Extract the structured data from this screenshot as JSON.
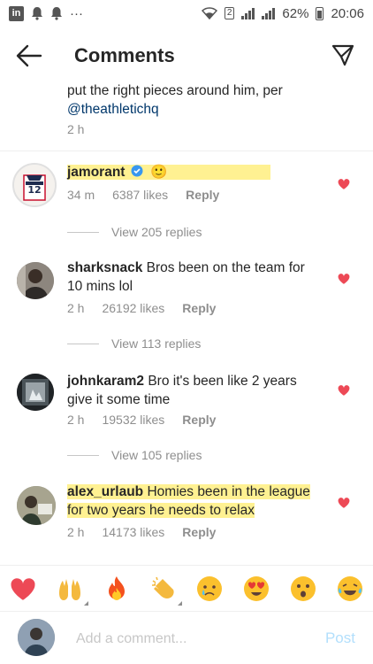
{
  "status_bar": {
    "time": "20:06",
    "battery": "62%",
    "sim_badge": "2",
    "dots": "···"
  },
  "header": {
    "title": "Comments",
    "back_icon": "arrow-left-icon",
    "share_icon": "paper-plane-icon"
  },
  "caption": {
    "text": "put the right pieces around him, per",
    "mention": "@theathletichq",
    "time": "2 h"
  },
  "comments": [
    {
      "username": "jamorant",
      "text": "",
      "emoji": "🙂",
      "time": "34 m",
      "likes": "6387 likes",
      "reply": "Reply",
      "view_replies": "View 205 replies",
      "verified": true
    },
    {
      "username": "sharksnack",
      "text": "Bros been on the team for 10 mins lol",
      "time": "2 h",
      "likes": "26192 likes",
      "reply": "Reply",
      "view_replies": "View 113 replies"
    },
    {
      "username": "johnkaram2",
      "text": "Bro it's been like 2 years give it some time",
      "time": "2 h",
      "likes": "19532 likes",
      "reply": "Reply",
      "view_replies": "View 105 replies"
    },
    {
      "username": "alex_urlaub",
      "text": "Homies been in the league for two years he needs to relax",
      "time": "2 h",
      "likes": "14173 likes",
      "reply": "Reply"
    }
  ],
  "emoji_bar": [
    "❤️",
    "🙌",
    "🔥",
    "👏",
    "😢",
    "😍",
    "😮",
    "😂"
  ],
  "composer": {
    "placeholder": "Add a comment...",
    "post_label": "Post"
  },
  "colors": {
    "heart": "#ed4956",
    "link": "#00376b",
    "secondary_text": "#8e8e8e",
    "highlight": "#ffec6e",
    "post_disabled": "#b2dffc",
    "verified": "#3897f0"
  }
}
